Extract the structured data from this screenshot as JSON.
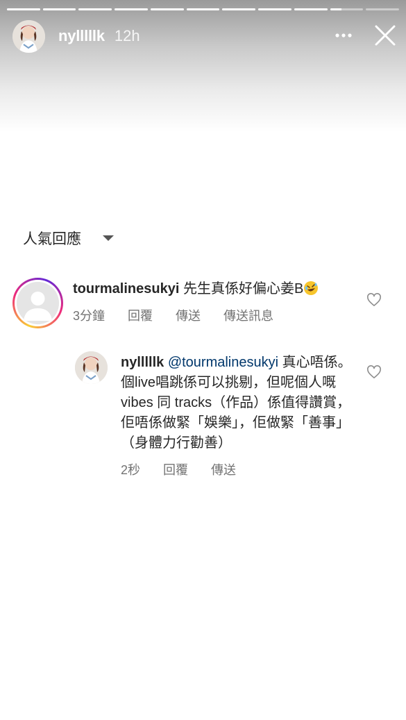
{
  "story": {
    "progress_segments": 11,
    "active_segment": 9,
    "active_fill_fraction": 0.35
  },
  "header": {
    "username": "nylllllk",
    "time": "12h"
  },
  "sort": {
    "label": "人氣回應"
  },
  "comments": [
    {
      "username": "tourmalinesukyi",
      "text": "先生真係好偏心姜B",
      "emoji": "rolling-on-floor-laughing-emoji",
      "age": "3分鐘",
      "reply": "回覆",
      "send": "傳送",
      "message": "傳送訊息"
    },
    {
      "username": "nylllllk",
      "mention": "@tourmalinesukyi",
      "text": " 真心唔係。個live唱跳係可以挑剔，但呢個人嘅 vibes 同 tracks（作品）係值得讚賞，佢唔係做緊「娛樂」，佢做緊「善事」（身體力行勸善）",
      "age": "2秒",
      "reply": "回覆",
      "send": "傳送"
    }
  ],
  "colors": {
    "mention": "#00376b",
    "meta": "#737373",
    "text": "#262626"
  }
}
